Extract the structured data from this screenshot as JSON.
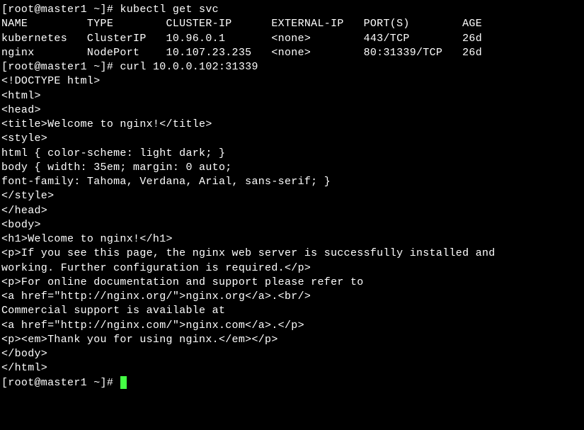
{
  "prompt1": "[root@master1 ~]# ",
  "cmd1": "kubectl get svc",
  "table": {
    "header": "NAME         TYPE        CLUSTER-IP      EXTERNAL-IP   PORT(S)        AGE",
    "row1": "kubernetes   ClusterIP   10.96.0.1       <none>        443/TCP        26d",
    "row2": "nginx        NodePort    10.107.23.235   <none>        80:31339/TCP   26d"
  },
  "prompt2": "[root@master1 ~]# ",
  "cmd2": "curl 10.0.0.102:31339",
  "out": {
    "l1": "<!DOCTYPE html>",
    "l2": "<html>",
    "l3": "<head>",
    "l4": "<title>Welcome to nginx!</title>",
    "l5": "<style>",
    "l6": "html { color-scheme: light dark; }",
    "l7": "body { width: 35em; margin: 0 auto;",
    "l8": "font-family: Tahoma, Verdana, Arial, sans-serif; }",
    "l9": "</style>",
    "l10": "</head>",
    "l11": "<body>",
    "l12": "<h1>Welcome to nginx!</h1>",
    "l13": "<p>If you see this page, the nginx web server is successfully installed and",
    "l14": "working. Further configuration is required.</p>",
    "l15": "",
    "l16": "<p>For online documentation and support please refer to",
    "l17": "<a href=\"http://nginx.org/\">nginx.org</a>.<br/>",
    "l18": "Commercial support is available at",
    "l19": "<a href=\"http://nginx.com/\">nginx.com</a>.</p>",
    "l20": "",
    "l21": "<p><em>Thank you for using nginx.</em></p>",
    "l22": "</body>",
    "l23": "</html>"
  },
  "prompt3": "[root@master1 ~]# "
}
